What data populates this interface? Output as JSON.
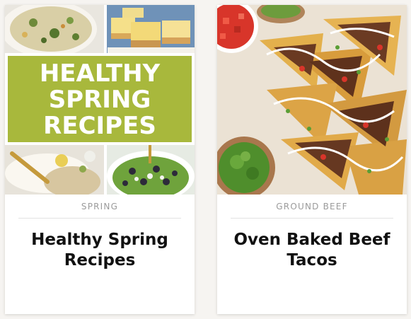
{
  "cards": [
    {
      "image_text": [
        "HEALTHY",
        "SPRING",
        "RECIPES"
      ],
      "category": "SPRING",
      "title": "Healthy Spring Recipes"
    },
    {
      "category": "GROUND BEEF",
      "title": "Oven Baked Beef Tacos"
    }
  ]
}
